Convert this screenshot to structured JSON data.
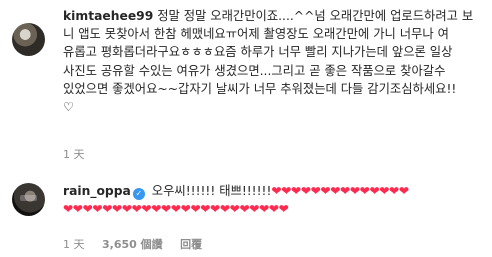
{
  "comment1": {
    "username": "kimtaehee99",
    "lines": [
      "정말 정말 오래간만이죠....^^넘 오래간만에 업로드하려고 보",
      "니 앱도 못찾아서 한참 헤맸네요ㅠ어제 촬영장도 오래간만에 가니 너무나 여",
      "유롭고 평화롭더라구요ㅎㅎㅎ요즘 하루가 너무 빨리 지나가는데 앞으론 일상",
      "사진도 공유할 수있는 여유가 생겼으면...그리고 곧 좋은 작품으로 찾아갈수",
      "있었으면 좋겠어요~~갑자기 날씨가 너무 추워졌는데 다들 감기조심하세요!!",
      "♡"
    ],
    "time": "1 天"
  },
  "comment2": {
    "username": "rain_oppa",
    "verified_icon": "✓",
    "text": "오우씨!!!!!! 태쁘!!!!!!",
    "hearts_inline": "❤❤❤❤❤❤❤❤❤❤❤❤❤❤",
    "hearts_line2": "❤❤❤❤❤❤❤❤❤❤❤❤❤❤❤❤❤❤❤❤❤❤❤",
    "time": "1 天",
    "likes": "3,650 個讚",
    "reply": "回覆"
  },
  "colors": {
    "heart": "#ff2a4f",
    "meta": "#8e8e8e",
    "verified": "#3897f0"
  }
}
